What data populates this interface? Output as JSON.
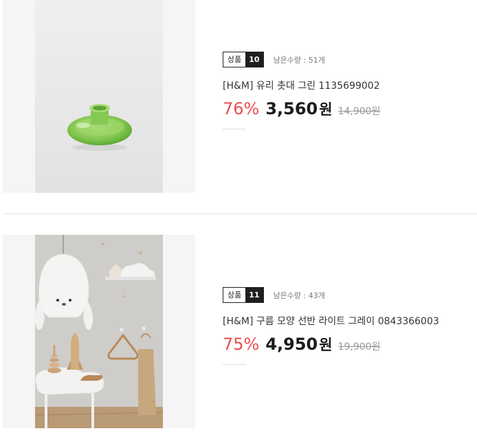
{
  "products": [
    {
      "badge_label": "상품",
      "badge_number": "10",
      "stock_text": "남은수량 : 51개",
      "title": "[H&M] 유리 촛대 그린 1135699002",
      "discount": "76%",
      "price": "3,560",
      "currency": "원",
      "original_price": "14,900원"
    },
    {
      "badge_label": "상품",
      "badge_number": "11",
      "stock_text": "남은수량 : 43개",
      "title": "[H&M] 구름 모양 선반 라이트 그레이 0843366003",
      "discount": "75%",
      "price": "4,950",
      "currency": "원",
      "original_price": "19,900원"
    }
  ],
  "colors": {
    "discount": "#ec4d4d",
    "badge_dark": "#1f1f1f",
    "thumb_bg": "#f5f5f5",
    "divider": "#e4e4e4"
  }
}
